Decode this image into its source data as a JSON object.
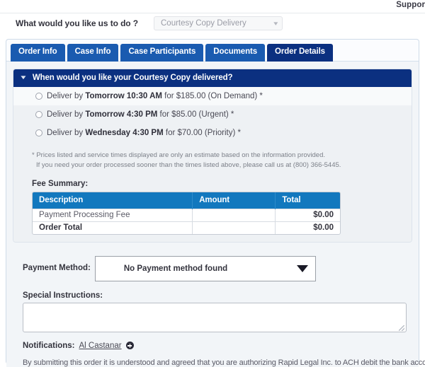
{
  "topbar": {
    "support_label": "Support"
  },
  "service_question": {
    "label": "What would you like us to do ?",
    "selected_value": "Courtesy Copy Delivery",
    "caret_icon": "chevron-down-icon"
  },
  "tabs": [
    {
      "label": "Order Info",
      "active": false
    },
    {
      "label": "Case Info",
      "active": false
    },
    {
      "label": "Case Participants",
      "active": false
    },
    {
      "label": "Documents",
      "active": false
    },
    {
      "label": "Order Details",
      "active": true
    }
  ],
  "panel": {
    "title": "When would you like your Courtesy Copy delivered?",
    "collapse_icon": "caret-down-icon"
  },
  "delivery_options": [
    {
      "prefix": "Deliver by ",
      "emphasis": "Tomorrow 10:30 AM",
      "suffix": " for $185.00 (On Demand) *",
      "selected": false
    },
    {
      "prefix": "Deliver by ",
      "emphasis": "Tomorrow 4:30 PM",
      "suffix": " for $85.00 (Urgent) *",
      "selected": false
    },
    {
      "prefix": "Deliver by ",
      "emphasis": "Wednesday 4:30 PM",
      "suffix": " for $70.00 (Priority) *",
      "selected": false
    }
  ],
  "footnote": {
    "line1": "* Prices listed and service times displayed are only an estimate based on the information provided.",
    "line2": "If you need your order processed sooner than the times listed above, please call us at (800) 366-5445."
  },
  "fee_summary": {
    "title": "Fee Summary:",
    "columns": [
      "Description",
      "Amount",
      "Total"
    ],
    "rows": [
      {
        "description": "Payment Processing Fee",
        "amount": "",
        "total": "$0.00",
        "is_total": false
      },
      {
        "description": "Order Total",
        "amount": "",
        "total": "$0.00",
        "is_total": true
      }
    ]
  },
  "payment_method": {
    "label": "Payment Method:",
    "value": "No Payment method found",
    "arrow_icon": "triangle-down-icon"
  },
  "special_instructions": {
    "label": "Special Instructions:",
    "value": "",
    "placeholder": ""
  },
  "notifications": {
    "label": "Notifications:",
    "recipient": "Al Castanar",
    "add_icon": "plus-circle-icon"
  },
  "disclaimer": {
    "text": "By submitting this order it is understood and agreed that you are authorizing Rapid Legal Inc. to ACH debit the bank account or charge"
  },
  "colors": {
    "tab_blue": "#1a5bb0",
    "tab_active_blue": "#0b3080",
    "panel_header_blue": "#0b3080",
    "table_header_blue": "#1278be",
    "page_bg": "#f2f5f8"
  }
}
